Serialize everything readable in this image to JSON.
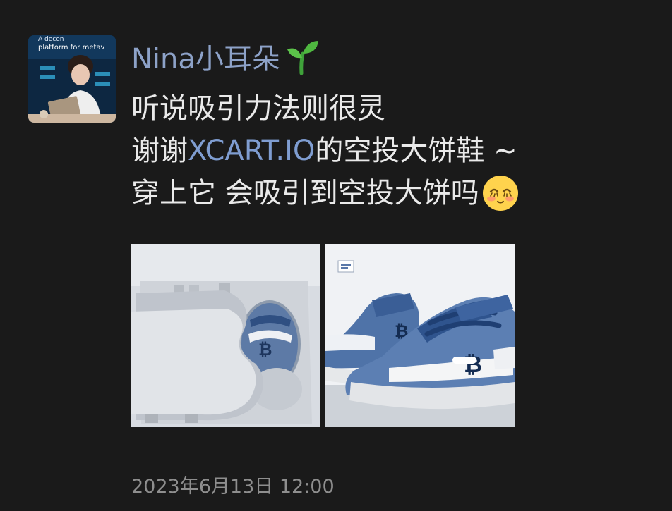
{
  "post": {
    "author_name": "Nina小耳朵",
    "author_icon": "sprout-emoji",
    "avatar_text": [
      "A decen",
      "platform for metav"
    ],
    "lines": [
      {
        "text": "听说吸引力法则很灵"
      },
      {
        "prefix": "谢谢",
        "link": "XCART.IO",
        "suffix": "的空投大饼鞋 ~"
      },
      {
        "text": "穿上它 会吸引到空投大饼吗",
        "emoji": "shy-smile-emoji"
      }
    ],
    "images": [
      {
        "name": "bitcoin-box-photo"
      },
      {
        "name": "bitcoin-sneaker-photo"
      }
    ],
    "timestamp": "2023年6月13日 12:00"
  },
  "colors": {
    "background": "#1a1a1a",
    "author_name": "#8da2c8",
    "text": "#eaeaea",
    "link": "#7f9dd1",
    "timestamp": "#8e8e8e"
  }
}
